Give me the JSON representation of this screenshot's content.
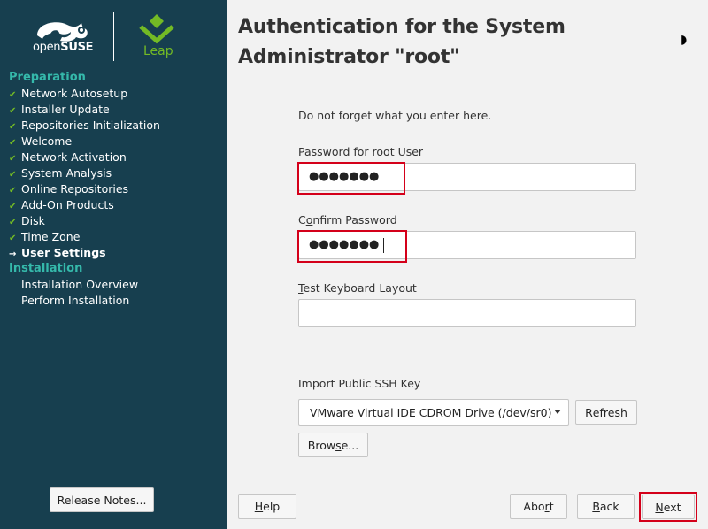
{
  "brand": {
    "opensuse_prefix": "open",
    "opensuse_suffix": "SUSE",
    "leap": "Leap",
    "colors": {
      "sidebar_bg": "#173f4f",
      "section_heading": "#35b9ab",
      "check": "#73ba25",
      "highlight": "#d4001a"
    }
  },
  "sidebar": {
    "sections": [
      {
        "heading": "Preparation",
        "steps": [
          {
            "label": "Network Autosetup",
            "status": "done"
          },
          {
            "label": "Installer Update",
            "status": "done"
          },
          {
            "label": "Repositories Initialization",
            "status": "done"
          },
          {
            "label": "Welcome",
            "status": "done"
          },
          {
            "label": "Network Activation",
            "status": "done"
          },
          {
            "label": "System Analysis",
            "status": "done"
          },
          {
            "label": "Online Repositories",
            "status": "done"
          },
          {
            "label": "Add-On Products",
            "status": "done"
          },
          {
            "label": "Disk",
            "status": "done"
          },
          {
            "label": "Time Zone",
            "status": "done"
          },
          {
            "label": "User Settings",
            "status": "current"
          }
        ]
      },
      {
        "heading": "Installation",
        "steps": [
          {
            "label": "Installation Overview",
            "status": "pending"
          },
          {
            "label": "Perform Installation",
            "status": "pending"
          }
        ]
      }
    ],
    "release_notes_button": "Release Notes..."
  },
  "main": {
    "title": "Authentication for the System Administrator \"root\"",
    "hint": "Do not forget what you enter here.",
    "password_label": "Password for root User",
    "password_value": "●●●●●●●",
    "confirm_label": "Confirm Password",
    "confirm_value": "●●●●●●●",
    "keyboard_label": "Test Keyboard Layout",
    "keyboard_value": "",
    "ssh_label": "Import Public SSH Key",
    "ssh_selected": "VMware Virtual IDE CDROM Drive (/dev/sr0)",
    "refresh_button": "Refresh",
    "browse_button": "Browse..."
  },
  "footer": {
    "help": "Help",
    "abort": "Abort",
    "back": "Back",
    "next": "Next"
  }
}
